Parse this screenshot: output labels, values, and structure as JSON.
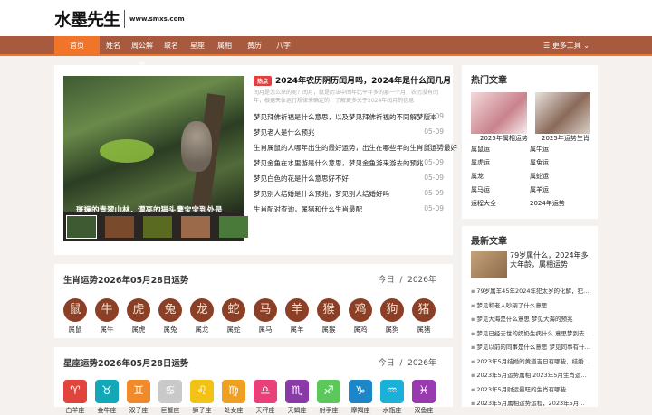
{
  "site": {
    "brand": "水墨先生",
    "url": "www.smxs.com"
  },
  "nav": {
    "items": [
      "首页",
      "姓名",
      "周公解梦",
      "取名",
      "星座",
      "属相",
      "黄历",
      "八字"
    ],
    "tool_label": "☰ 更多工具"
  },
  "hero": {
    "caption": "斑斓的青翠山林，漂亮的猫头鹰宝宝到处是",
    "tag": "热点",
    "headline": "2024年农历阴历闰月吗，2024年是什么闰几月",
    "summary": "闰月是怎么来的呢？闰月，就是历法中闰年比平年多的那一个月，农历没有闰年，根据天体运行规律来确定的，了解更多关于2024年闰月的信息",
    "news": [
      {
        "title": "梦见拜佛祈福是什么意思，以及梦见拜佛祈福的不同解梦版本",
        "date": "05-09"
      },
      {
        "title": "梦见老人是什么预兆",
        "date": "05-09"
      },
      {
        "title": "生肖属鼠的人哪年出生的最好运势，出生在哪些年的生肖鼠运势最好",
        "date": "05-09"
      },
      {
        "title": "梦见金鱼在水里游是什么意思，梦见金鱼游来游去的预兆",
        "date": "05-09"
      },
      {
        "title": "梦见白色的花是什么意思好不好",
        "date": "05-09"
      },
      {
        "title": "梦见别人结婚是什么预兆，梦见别人结婚好吗",
        "date": "05-09"
      },
      {
        "title": "生肖配对查询，属猪和什么生肖最配",
        "date": "05-09"
      }
    ]
  },
  "zodiac": {
    "title": "生肖运势2026年05月28日运势",
    "tab1": "今日",
    "tab2": "2026年",
    "items": [
      {
        "g": "鼠",
        "l": "属鼠"
      },
      {
        "g": "牛",
        "l": "属牛"
      },
      {
        "g": "虎",
        "l": "属虎"
      },
      {
        "g": "兔",
        "l": "属兔"
      },
      {
        "g": "龙",
        "l": "属龙"
      },
      {
        "g": "蛇",
        "l": "属蛇"
      },
      {
        "g": "马",
        "l": "属马"
      },
      {
        "g": "羊",
        "l": "属羊"
      },
      {
        "g": "猴",
        "l": "属猴"
      },
      {
        "g": "鸡",
        "l": "属鸡"
      },
      {
        "g": "狗",
        "l": "属狗"
      },
      {
        "g": "猪",
        "l": "属猪"
      }
    ]
  },
  "stars": {
    "title": "星座运势2026年05月28日运势",
    "tab1": "今日",
    "tab2": "2026年",
    "items": [
      {
        "g": "♈",
        "l": "白羊座",
        "c": "#e0443c"
      },
      {
        "g": "♉",
        "l": "金牛座",
        "c": "#12a8b8"
      },
      {
        "g": "♊",
        "l": "双子座",
        "c": "#f08a2a"
      },
      {
        "g": "♋",
        "l": "巨蟹座",
        "c": "#c9c9c9"
      },
      {
        "g": "♌",
        "l": "狮子座",
        "c": "#f2c316"
      },
      {
        "g": "♍",
        "l": "处女座",
        "c": "#f0a020"
      },
      {
        "g": "♎",
        "l": "天秤座",
        "c": "#e9407a"
      },
      {
        "g": "♏",
        "l": "天蝎座",
        "c": "#8a3aa8"
      },
      {
        "g": "♐",
        "l": "射手座",
        "c": "#5cc85c"
      },
      {
        "g": "♑",
        "l": "摩羯座",
        "c": "#1c86c8"
      },
      {
        "g": "♒",
        "l": "水瓶座",
        "c": "#1ab0d8"
      },
      {
        "g": "♓",
        "l": "双鱼座",
        "c": "#9a3ab0"
      }
    ]
  },
  "side1": {
    "title": "热门文章",
    "img1": "2025年属相运势",
    "img2": "2025年运势生肖",
    "links": [
      "属鼠运",
      "属牛运",
      "属虎运",
      "属兔运",
      "属龙",
      "属蛇运",
      "属马运",
      "属羊运",
      "运程大全",
      "2024年运势"
    ]
  },
  "side2": {
    "title": "最新文章",
    "feature": "79岁属什么，2024年多大年龄，属相运势",
    "list": [
      "79岁属羊45年2024年犯太岁的化解，犯太岁佩戴什么",
      "梦见和老人吵架了什么意思",
      "梦见大海是什么意思 梦见大海的预兆",
      "梦见已经去世的奶奶生病什么 意思梦到去世奶奶",
      "梦见以前的同事是什么意思 梦见同事有什么预兆",
      "2023年5月结婚的黄道吉日有哪些，结婚吉日一览表",
      "2023年5月运势属相 2023年5月生肖运势大全",
      "2023年5月财运最旺的生肖有哪些",
      "2023年5月属相运势运程，2023年5月生肖运势详解"
    ]
  }
}
